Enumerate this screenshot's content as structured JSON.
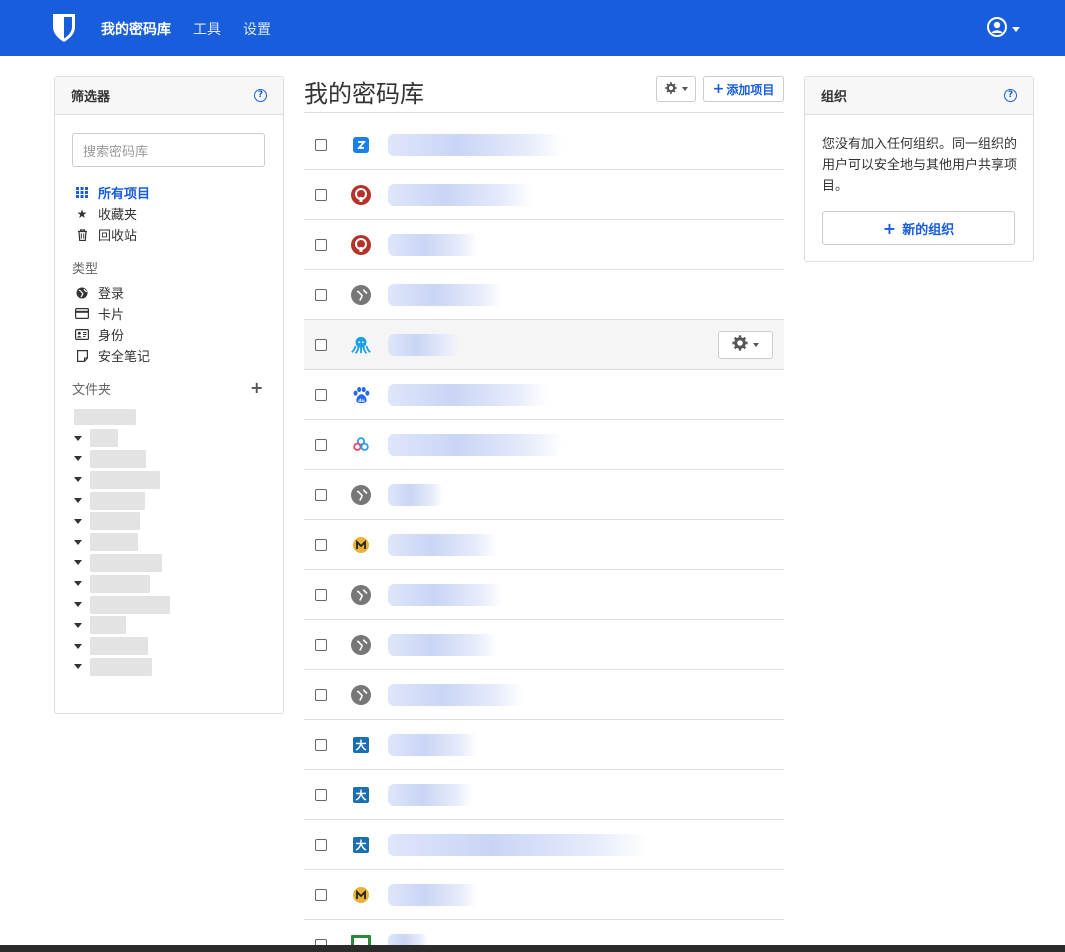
{
  "nav": {
    "logo_icon": "shield-logo-icon",
    "links": [
      "我的密码库",
      "工具",
      "设置"
    ],
    "user_icon": "user-circle-icon",
    "accent": "#175ddc"
  },
  "filters": {
    "title": "筛选器",
    "search_placeholder": "搜索密码库",
    "all_items": [
      {
        "label": "所有项目",
        "icon": "grid-icon"
      },
      {
        "label": "收藏夹",
        "icon": "star-icon"
      },
      {
        "label": "回收站",
        "icon": "trash-icon"
      }
    ],
    "types_heading": "类型",
    "types": [
      {
        "label": "登录",
        "icon": "globe-icon"
      },
      {
        "label": "卡片",
        "icon": "credit-card-icon"
      },
      {
        "label": "身份",
        "icon": "id-card-icon"
      },
      {
        "label": "安全笔记",
        "icon": "note-icon"
      }
    ],
    "folders_heading": "文件夹",
    "folder_count": 13
  },
  "vault": {
    "title": "我的密码库",
    "add_label": "添加项目",
    "items": [
      {
        "icon": "blue-cube-logo-icon",
        "color": "#1a7ff0"
      },
      {
        "icon": "red-ring-logo-icon",
        "color": "#b5322a"
      },
      {
        "icon": "red-ring-logo-icon",
        "color": "#b5322a"
      },
      {
        "icon": "globe-icon",
        "color": "#777777"
      },
      {
        "icon": "octopus-logo-icon",
        "color": "#1aa0e6"
      },
      {
        "icon": "baidu-paw-logo-icon",
        "color": "#2468f2"
      },
      {
        "icon": "cloud-logo-icon",
        "color": "#2f9ef0"
      },
      {
        "icon": "globe-icon",
        "color": "#777777"
      },
      {
        "icon": "yellow-badge-logo-icon",
        "color": "#e8b33a"
      },
      {
        "icon": "globe-icon",
        "color": "#777777"
      },
      {
        "icon": "globe-icon",
        "color": "#777777"
      },
      {
        "icon": "globe-icon",
        "color": "#777777"
      },
      {
        "icon": "da-logo-icon",
        "color": "#1a6fb0",
        "text": "大"
      },
      {
        "icon": "da-logo-icon",
        "color": "#1a6fb0",
        "text": "大"
      },
      {
        "icon": "da-logo-icon",
        "color": "#1a6fb0",
        "text": "大"
      },
      {
        "icon": "yellow-badge-logo-icon",
        "color": "#e8b33a"
      },
      {
        "icon": "green-square-logo-icon",
        "color": "#2a8a3a"
      }
    ]
  },
  "orgs": {
    "title": "组织",
    "description": "您没有加入任何组织。同一组织的用户可以安全地与其他用户共享项目。",
    "new_org_label": "新的组织"
  }
}
